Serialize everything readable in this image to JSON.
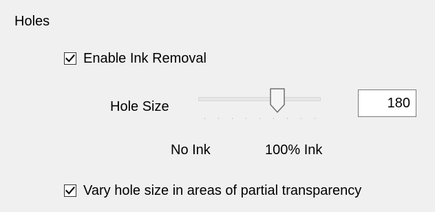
{
  "group": {
    "title": "Holes"
  },
  "enable_ink_removal": {
    "label": "Enable Ink Removal",
    "checked": true
  },
  "hole_size": {
    "label": "Hole Size",
    "value": "180",
    "slider_fraction": 0.66,
    "tick_count": 9,
    "min_label": "No Ink",
    "max_label": "100% Ink"
  },
  "vary_hole_size": {
    "label": "Vary hole size in areas of partial transparency",
    "checked": true
  }
}
